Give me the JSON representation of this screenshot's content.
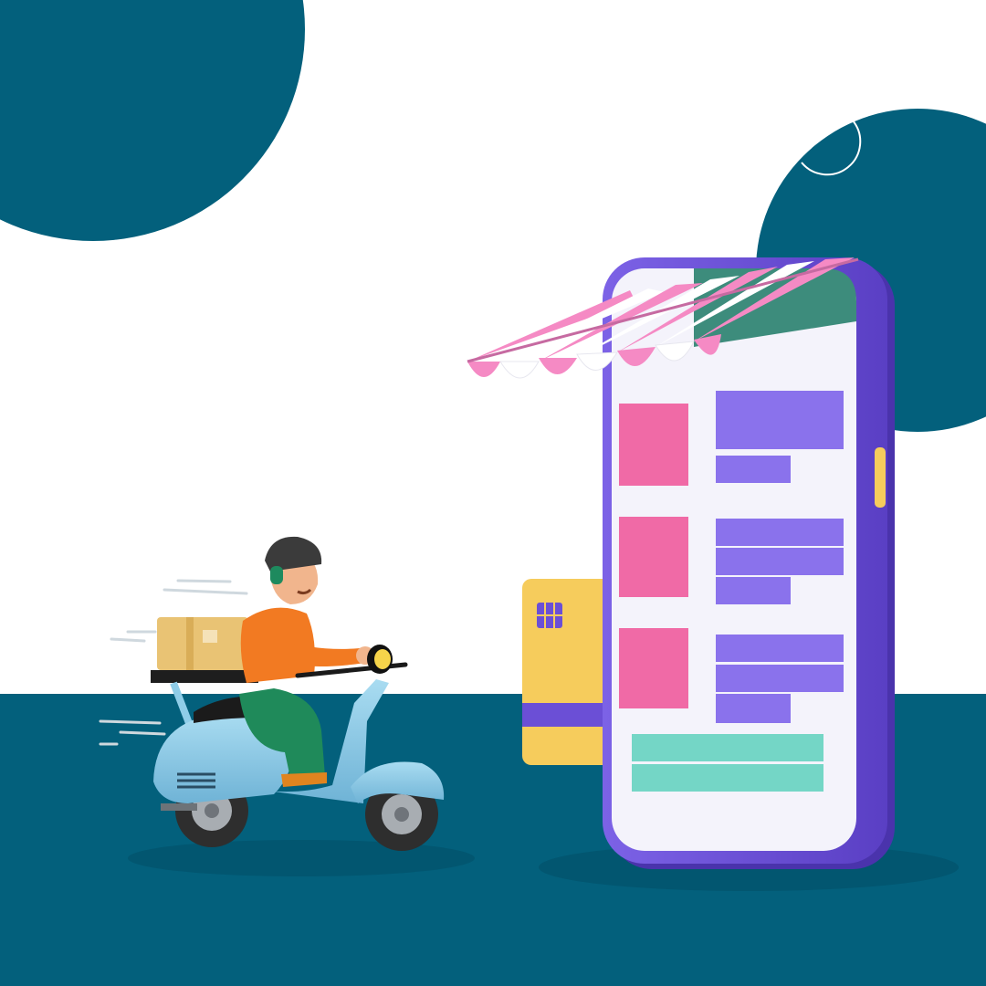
{
  "colors": {
    "background": "#ffffff",
    "teal": "#03607c",
    "phone_frame": "#6b4fd6",
    "phone_frame_dark": "#5a3fc4",
    "phone_screen": "#f4f3fb",
    "product_thumb": "#f06aa6",
    "product_text_line": "#8a72ec",
    "checkout_bar": "#74d6c6",
    "awning_pink": "#f58ac4",
    "awning_white": "#fdfdfd",
    "card_yellow": "#f6cc5c",
    "card_stripe": "#6b4fd6",
    "scooter_body": "#8fcde8",
    "rider_shirt": "#f27a22",
    "rider_pants": "#1f8a5a",
    "helmet": "#3b3b3b",
    "parcel": "#e9c374"
  },
  "scene": {
    "illustration": "delivery-scooter-to-mobile-shop",
    "product_rows": 3
  }
}
